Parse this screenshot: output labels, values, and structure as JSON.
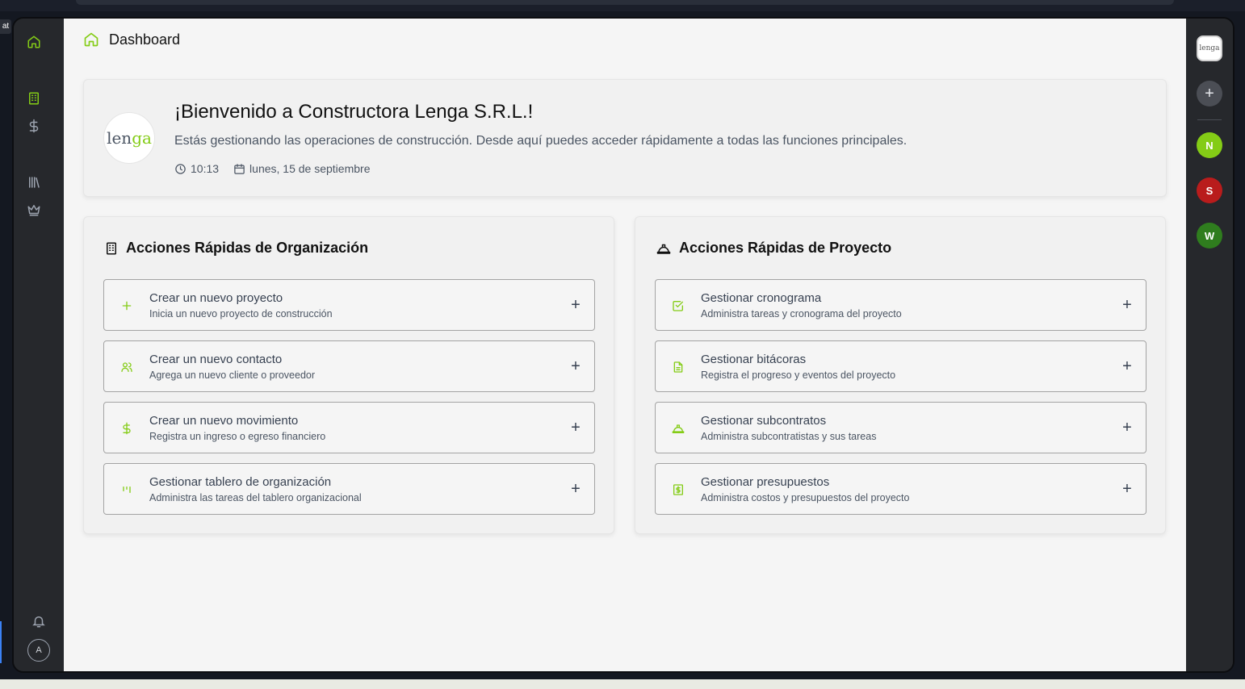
{
  "app": {
    "colors": {
      "accent": "#84cc16",
      "sidebar": "#26282c",
      "main_bg": "#f5f5f5"
    }
  },
  "left_rail": {
    "icons": [
      "home-icon",
      "building-icon",
      "dollar-icon",
      "library-icon",
      "crown-icon",
      "bell-icon"
    ],
    "avatar_initial": "A"
  },
  "right_rail": {
    "logo_text": "lenga",
    "add_label": "+",
    "users": [
      {
        "initial": "N",
        "color": "#84cc16"
      },
      {
        "initial": "S",
        "color": "#b91c1c"
      },
      {
        "initial": "W",
        "color": "#2f7d1e"
      }
    ]
  },
  "header": {
    "title": "Dashboard"
  },
  "welcome": {
    "logo_text_a": "len",
    "logo_text_b": "ga",
    "title": "¡Bienvenido a Constructora Lenga S.R.L.!",
    "description": "Estás gestionando las operaciones de construcción. Desde aquí puedes acceder rápidamente a todas las funciones principales.",
    "time": "10:13",
    "date": "lunes, 15 de septiembre"
  },
  "org_panel": {
    "title": "Acciones Rápidas de Organización",
    "actions": [
      {
        "title": "Crear un nuevo proyecto",
        "subtitle": "Inicia un nuevo proyecto de construcción",
        "icon": "plus-icon"
      },
      {
        "title": "Crear un nuevo contacto",
        "subtitle": "Agrega un nuevo cliente o proveedor",
        "icon": "users-icon"
      },
      {
        "title": "Crear un nuevo movimiento",
        "subtitle": "Registra un ingreso o egreso financiero",
        "icon": "dollar-icon"
      },
      {
        "title": "Gestionar tablero de organización",
        "subtitle": "Administra las tareas del tablero organizacional",
        "icon": "kanban-icon"
      }
    ]
  },
  "project_panel": {
    "title": "Acciones Rápidas de Proyecto",
    "actions": [
      {
        "title": "Gestionar cronograma",
        "subtitle": "Administra tareas y cronograma del proyecto",
        "icon": "calendar-check-icon"
      },
      {
        "title": "Gestionar bitácoras",
        "subtitle": "Registra el progreso y eventos del proyecto",
        "icon": "file-text-icon"
      },
      {
        "title": "Gestionar subcontratos",
        "subtitle": "Administra subcontratistas y sus tareas",
        "icon": "hard-hat-icon"
      },
      {
        "title": "Gestionar presupuestos",
        "subtitle": "Administra costos y presupuestos del proyecto",
        "icon": "receipt-icon"
      }
    ]
  },
  "plus_glyph": "+"
}
